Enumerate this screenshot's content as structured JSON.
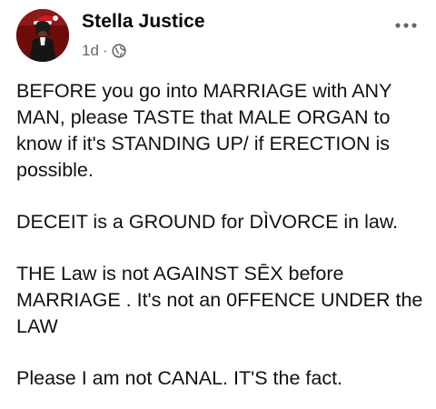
{
  "post": {
    "author": "Stella Justice",
    "time": "1d",
    "separator": "·",
    "audience_icon": "globe-icon",
    "more_icon": "more-options-icon",
    "paragraphs": [
      "BEFORE you go into MARRIAGE with ANY MAN, please TASTE that MALE ORGAN to know if it's STANDING UP/ if ERECTION is possible.",
      "DECEIT is a GROUND for DÌVORCE in law.",
      "THE Law is not AGAINST SĒX before MARRIAGE . It's not an 0FFENCE UNDER the LAW",
      "Please I am not CANAL. IT'S the fact."
    ]
  },
  "colors": {
    "text": "#111111",
    "secondary": "#65676b",
    "avatar_bg": "#7a1010"
  }
}
